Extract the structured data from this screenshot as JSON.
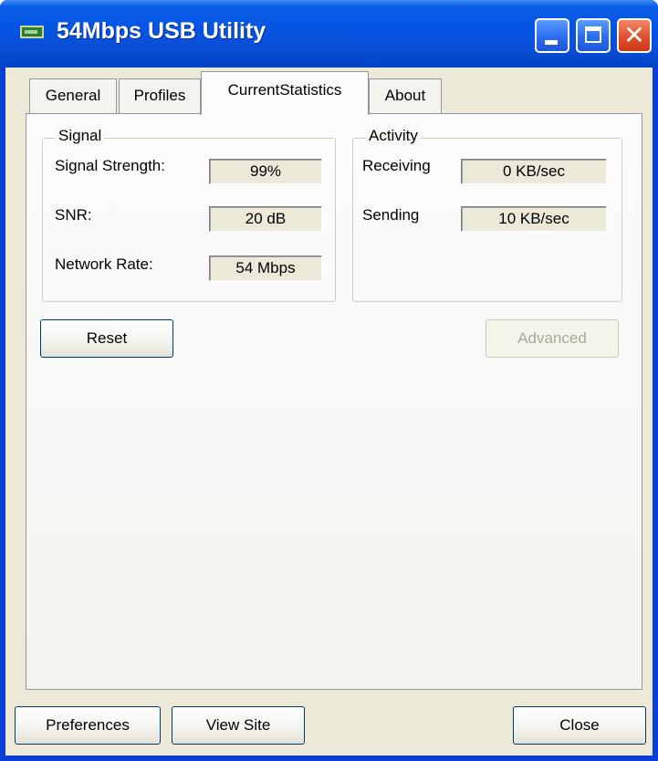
{
  "window": {
    "title": "54Mbps USB Utility"
  },
  "tabs": {
    "items": [
      "General",
      "Profiles",
      "CurrentStatistics",
      "About"
    ],
    "active": "CurrentStatistics"
  },
  "signal": {
    "group_label": "Signal",
    "strength_label": "Signal Strength:",
    "strength_value": "99%",
    "snr_label": "SNR:",
    "snr_value": "20 dB",
    "rate_label": "Network Rate:",
    "rate_value": "54 Mbps"
  },
  "activity": {
    "group_label": "Activity",
    "receiving_label": "Receiving",
    "receiving_value": "0 KB/sec",
    "sending_label": "Sending",
    "sending_value": "10 KB/sec"
  },
  "buttons": {
    "reset": "Reset",
    "advanced": "Advanced",
    "preferences": "Preferences",
    "view_site": "View Site",
    "close": "Close"
  },
  "icons": {
    "app": "network-adapter-icon",
    "minimize": "minimize-icon",
    "maximize": "maximize-icon",
    "close": "close-icon"
  },
  "colors": {
    "titlebar": "#0554e3",
    "client_bg": "#ece9d8",
    "close_button": "#e0502c"
  }
}
